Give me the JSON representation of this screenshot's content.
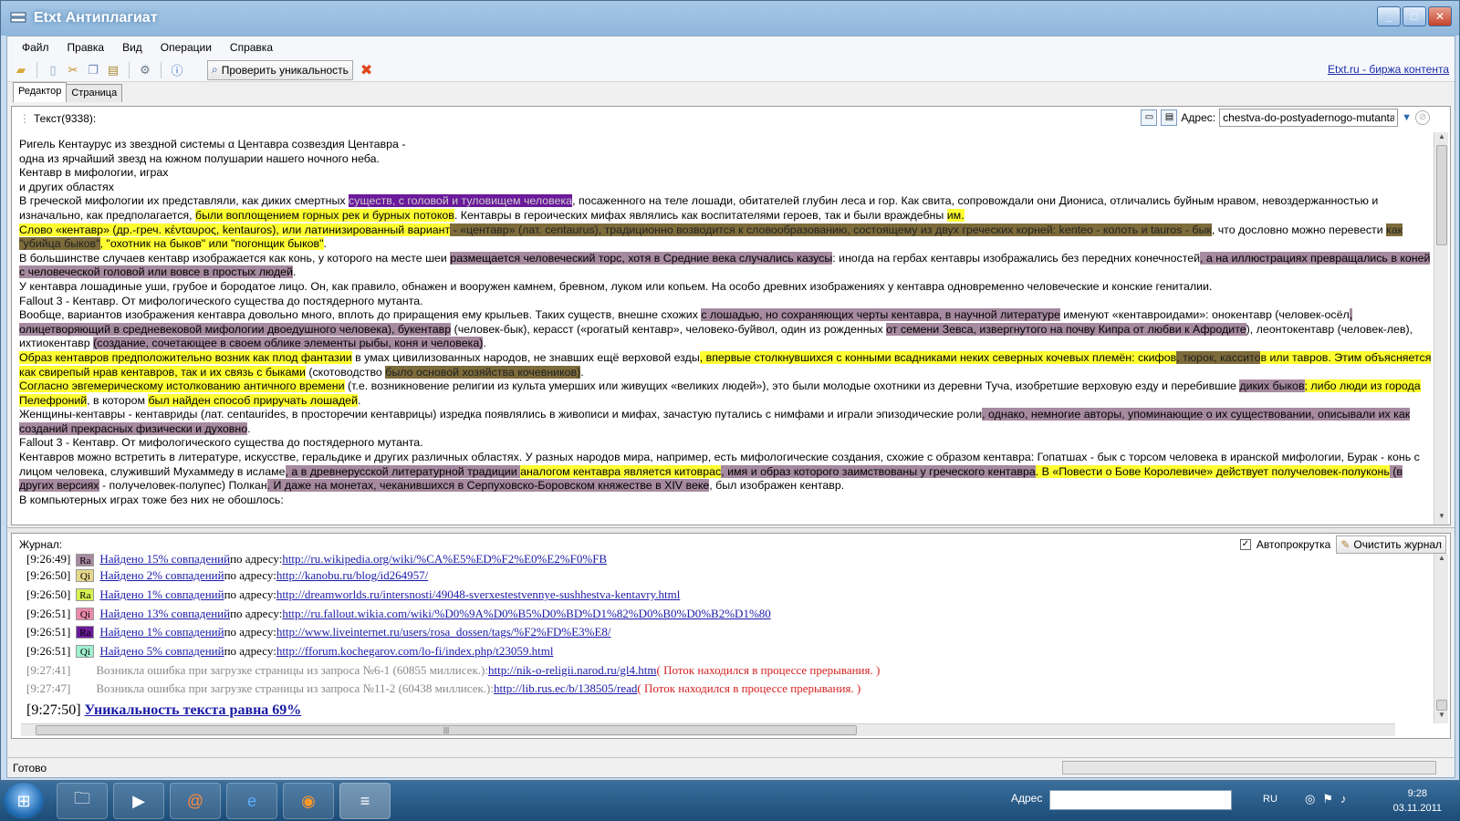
{
  "window": {
    "title": "Etxt Антиплагиат"
  },
  "menu": [
    "Файл",
    "Правка",
    "Вид",
    "Операции",
    "Справка"
  ],
  "toolbar": {
    "check_label": "Проверить уникальность",
    "etxt_link": "Etxt.ru - биржа контента"
  },
  "tabs": [
    "Редактор",
    "Страница"
  ],
  "editor": {
    "header_label": "Текст(9338):",
    "address_label": "Адрес:",
    "address_value": "chestva-do-postyadernogo-mutanta",
    "paragraphs": [
      [
        {
          "t": "Ригель Кентаурус из звездной системы α Центавра созвездия Центавра -"
        }
      ],
      [
        {
          "t": "одна из ярчайший звезд на южном полушарии нашего ночного неба."
        }
      ],
      [
        {
          "t": "Кентавр в мифологии, играх"
        }
      ],
      [
        {
          "t": "и других областях"
        }
      ],
      [
        {
          "t": "В греческой мифологии их представляли, как диких смертных "
        },
        {
          "t": "существ, с головой и туловищем человека",
          "h": "p"
        },
        {
          "t": ", посаженного на теле лошади, обитателей глубин леса и гор. Как свита, сопровождали они Диониса, отличались буйным нравом, невоздержанностью и изначально, как предполагается, "
        },
        {
          "t": "были воплощением горных рек и бурных потоков",
          "h": "y"
        },
        {
          "t": ". Кентавры в героических мифах являлись как воспитателями героев, так и были враждебны "
        },
        {
          "t": "им.",
          "h": "y"
        }
      ],
      [
        {
          "t": "Слово «кентавр» (др.-греч. κένταυρος, kentauros), или латинизированный вариант",
          "h": "y"
        },
        {
          "t": " - «центавр» (лат. centaurus), традиционно возводится к словообразованию, состоящему из двух греческих корней: kenteo",
          "h": "b"
        },
        {
          "t": " - колоть и tauros - бык",
          "h": "b"
        },
        {
          "t": ", что дословно можно перевести "
        },
        {
          "t": "как \"убийца быков\"",
          "h": "b"
        },
        {
          "t": ", \"охотник на быков\" или \"погонщик быков\"",
          "h": "y"
        },
        {
          "t": "."
        }
      ],
      [
        {
          "t": "В большинстве случаев кентавр изображается как конь, у которого на месте шеи "
        },
        {
          "t": "размещается человеческий торс, хотя в Средние века случались казусы",
          "h": "m"
        },
        {
          "t": ": иногда на гербах кентавры изображались без передних конечностей"
        },
        {
          "t": ", а на иллюстрациях превращались в коней с человеческой головой или вовсе в простых людей",
          "h": "m"
        },
        {
          "t": "."
        }
      ],
      [
        {
          "t": "У кентавра лошадиные уши, грубое и бородатое лицо. Он, как правило, обнажен и вооружен камнем, бревном, луком или копьем. На особо древних изображениях у кентавра одновременно человеческие и конские гениталии."
        }
      ],
      [
        {
          "t": "Fallout 3 - Кентавр. От мифологического существа до постядерного мутанта."
        }
      ],
      [
        {
          "t": "Вообще, вариантов изображения кентавра довольно много, вплоть до приращения ему крыльев. Таких существ, внешне схожих "
        },
        {
          "t": "с лошадью, но сохраняющих черты кентавра, в научной литературе",
          "h": "m"
        },
        {
          "t": " именуют «кентавроидами»: онокентавр (человек-осёл"
        },
        {
          "t": ", олицетворяющий в средневековой мифологии двоедушного человека), букентавр",
          "h": "m"
        },
        {
          "t": " (человек-бык), керасст («рогатый кентавр», человеко-буйвол, один из рожденных "
        },
        {
          "t": "от семени Зевса, извергнутого на почву Кипра от любви к Афродите",
          "h": "m"
        },
        {
          "t": "), леонтокентавр (человек-лев), ихтиокентавр "
        },
        {
          "t": "(создание, сочетающее в своем облике элементы рыбы, коня и человека)",
          "h": "m"
        },
        {
          "t": "."
        }
      ],
      [
        {
          "t": "Образ кентавров предположительно возник как плод фантазии",
          "h": "y"
        },
        {
          "t": " в умах цивилизованных народов, не знавших ещё верховой езды"
        },
        {
          "t": ", впервые столкнувшихся с конными всадниками неких северных кочевых племён: скифов",
          "h": "y"
        },
        {
          "t": ", тюрок, кассито",
          "h": "b"
        },
        {
          "t": "в или тавров. Этим объясняется как свирепый нрав кентавров, так и их связь с быками",
          "h": "y"
        },
        {
          "t": " (скотоводство "
        },
        {
          "t": "было основой хозяйства кочевников)",
          "h": "b"
        },
        {
          "t": "."
        }
      ],
      [
        {
          "t": "Согласно эвгемерическому истолкованию античного времени",
          "h": "y"
        },
        {
          "t": " (т.е. возникновение религии из культа умерших или живущих «великих людей»), это были молодые охотники из деревни Туча, изобретшие верховую езду и перебившие "
        },
        {
          "t": "диких быков",
          "h": "m"
        },
        {
          "t": "; либо люди из города Пелефроний",
          "h": "y"
        },
        {
          "t": ", в котором "
        },
        {
          "t": "был найден способ приручать лошадей",
          "h": "y"
        },
        {
          "t": "."
        }
      ],
      [
        {
          "t": "Женщины-кентавры - кентавриды (лат. centaurides, в просторечии кентаврицы) изредка появлялись в живописи и мифах, зачастую путались с нимфами и играли эпизодические роли"
        },
        {
          "t": ", однако, немногие авторы, упоминающие о их существовании, описывали их как созданий прекрасных физически и духовно",
          "h": "m"
        },
        {
          "t": "."
        }
      ],
      [
        {
          "t": "Fallout 3 - Кентавр. От мифологического существа до постядерного мутанта."
        }
      ],
      [
        {
          "t": "Кентавров можно встретить в литературе, искусстве, геральдике и других различных областях. У разных народов мира, например, есть мифологические создания, схожие с образом кентавра: Гопатшах - бык с торсом человека в иранской мифологии, Бурак - конь с лицом человека, служивший Мухаммеду в исламе"
        },
        {
          "t": ", а в древнерусской литературной традиции ",
          "h": "m"
        },
        {
          "t": "аналогом кентавра является китоврас",
          "h": "y"
        },
        {
          "t": ", имя и образ которого заимствованы у греческого кентавра",
          "h": "m"
        },
        {
          "t": ". В «Повести о Бове Королевиче» действует получеловек-полуконь",
          "h": "y"
        },
        {
          "t": " (в других версиях",
          "h": "m"
        },
        {
          "t": " - получеловек-полупес) Полкан"
        },
        {
          "t": ". И даже на монетах, чеканившихся в Серпуховско-Боровском княжестве в XIV веке",
          "h": "m"
        },
        {
          "t": ", был изображен кентавр."
        }
      ],
      [
        {
          "t": "В компьютерных играх тоже без них не обошлось:"
        }
      ]
    ]
  },
  "journal": {
    "label": "Журнал:",
    "autoscroll_label": "Автопрокрутка",
    "clear_label": "Очистить журнал",
    "entries": [
      {
        "time": "[9:26:49]",
        "tag": "Ra",
        "tag_color": "#a68a9f",
        "link": "Найдено 15% совпадений",
        "suffix": " по адресу: ",
        "url": "http://ru.wikipedia.org/wiki/%CA%E5%ED%F2%E0%E2%F0%FB"
      },
      {
        "time": "[9:26:50]",
        "tag": "Qi",
        "tag_color": "#e6d88a",
        "link": "Найдено 2% совпадений",
        "suffix": " по адресу: ",
        "url": "http://kanobu.ru/blog/id264957/"
      },
      {
        "time": "[9:26:50]",
        "tag": "Ra",
        "tag_color": "#d8f050",
        "link": "Найдено 1% совпадений",
        "suffix": " по адресу: ",
        "url": "http://dreamworlds.ru/intersnosti/49048-sverxestestvennye-sushhestva-kentavry.html"
      },
      {
        "time": "[9:26:51]",
        "tag": "Qi",
        "tag_color": "#e88aa8",
        "link": "Найдено 13% совпадений",
        "suffix": " по адресу: ",
        "url": "http://ru.fallout.wikia.com/wiki/%D0%9A%D0%B5%D0%BD%D1%82%D0%B0%D0%B2%D1%80"
      },
      {
        "time": "[9:26:51]",
        "tag": "Ra",
        "tag_color": "#6a1a9a",
        "link": "Найдено 1% совпадений",
        "suffix": " по адресу: ",
        "url": "http://www.liveinternet.ru/users/rosa_dossen/tags/%F2%FD%E3%E8/"
      },
      {
        "time": "[9:26:51]",
        "tag": "Qi",
        "tag_color": "#9ff0d0",
        "link": "Найдено 5% совпадений",
        "suffix": " по адресу: ",
        "url": "http://fforum.kochegarov.com/lo-fi/index.php/t23059.html"
      }
    ],
    "errors": [
      {
        "time": "[9:27:41]",
        "text": "Возникла ошибка при загрузке страницы из запроса №6-1 (60855 миллисек.): ",
        "url": "http://nik-o-religii.narod.ru/gl4.htm",
        "reason": " ( Поток находился в процессе прерывания. )"
      },
      {
        "time": "[9:27:47]",
        "text": "Возникла ошибка при загрузке страницы из запроса №11-2 (60438 миллисек.): ",
        "url": "http://lib.rus.ec/b/138505/read",
        "reason": " ( Поток находился в процессе прерывания. )"
      }
    ],
    "final_time": "[9:27:50]",
    "final_text": "Уникальность текста равна 69%"
  },
  "status": {
    "text": "Готово"
  },
  "taskbar": {
    "address_label": "Адрес",
    "lang": "RU",
    "time": "9:28",
    "date": "03.11.2011"
  }
}
